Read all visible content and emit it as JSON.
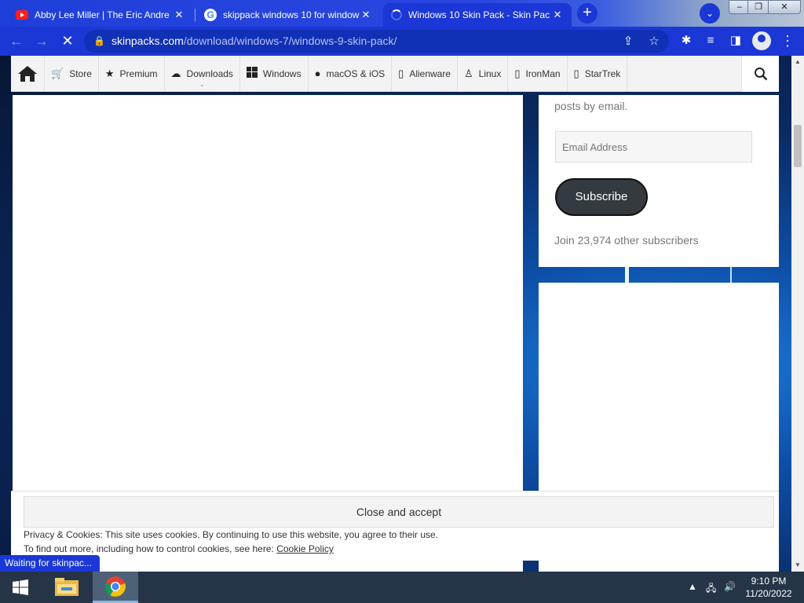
{
  "browser": {
    "tabs": [
      {
        "title": "Abby Lee Miller | The Eric Andre",
        "favicon": "youtube-icon"
      },
      {
        "title": "skippack windows 10 for window",
        "favicon": "google-icon"
      },
      {
        "title": "Windows 10 Skin Pack - Skin Pac",
        "favicon": "loading-spinner-icon",
        "active": true
      }
    ],
    "new_tab_symbol": "+",
    "url_host": "skinpacks.com",
    "url_path": "/download/windows-7/windows-9-skin-pack/",
    "status_text": "Waiting for skinpac..."
  },
  "nav": {
    "items": [
      {
        "label": "Store",
        "icon": "cart-icon"
      },
      {
        "label": "Premium",
        "icon": "star-icon"
      },
      {
        "label": "Downloads",
        "icon": "cloud-download-icon"
      },
      {
        "label": "Windows",
        "icon": "windows-logo-icon"
      },
      {
        "label": "macOS & iOS",
        "icon": "apple-icon"
      },
      {
        "label": "Alienware",
        "icon": "device-icon"
      },
      {
        "label": "Linux",
        "icon": "tux-icon"
      },
      {
        "label": "IronMan",
        "icon": "device-icon"
      },
      {
        "label": "StarTrek",
        "icon": "device-icon"
      }
    ]
  },
  "subscribe": {
    "description": "posts by email.",
    "email_placeholder": "Email Address",
    "button_label": "Subscribe",
    "subscriber_count": "Join 23,974 other subscribers"
  },
  "cookie": {
    "accept_label": "Close and accept",
    "line1": "Privacy & Cookies: This site uses cookies. By continuing to use this website, you agree to their use.",
    "line2_prefix": "To find out more, including how to control cookies, see here: ",
    "policy_link": "Cookie Policy"
  },
  "taskbar": {
    "time": "9:10 PM",
    "date": "11/20/2022"
  },
  "colors": {
    "chrome_blue": "#1b37d6",
    "subscribe_button": "#333a40",
    "taskbar": "#253447"
  }
}
